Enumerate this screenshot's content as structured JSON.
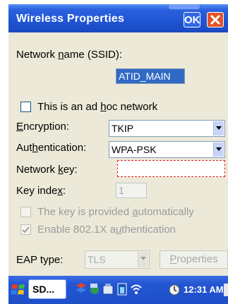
{
  "window": {
    "title": "Wireless Properties",
    "ok_label": "OK"
  },
  "form": {
    "ssid_label_pre": "Network ",
    "ssid_label_key": "n",
    "ssid_label_post": "ame (SSID):",
    "ssid_value": "ATID_MAIN",
    "adhoc_pre": "This is an ad ",
    "adhoc_key": "h",
    "adhoc_post": "oc network",
    "adhoc_checked": false,
    "encryption_key": "E",
    "encryption_post": "ncryption:",
    "encryption_value": "TKIP",
    "auth_pre": "Aut",
    "auth_key": "h",
    "auth_post": "entication:",
    "auth_value": "WPA-PSK",
    "netkey_pre": "Network ",
    "netkey_key": "k",
    "netkey_post": "ey:",
    "netkey_value": "",
    "keyidx_pre": "Key inde",
    "keyidx_key": "x",
    "keyidx_post": ":",
    "keyidx_value": "1",
    "keyauto_pre": "The key is provided ",
    "keyauto_key": "a",
    "keyauto_post": "utomatically",
    "keyauto_checked": false,
    "enable8021x_pre": "Enable 802.1X a",
    "enable8021x_key": "u",
    "enable8021x_post": "thentication",
    "enable8021x_checked": true,
    "eap_label": "EAP type:",
    "eap_value": "TLS",
    "properties_key": "P",
    "properties_post": "roperties"
  },
  "taskbar": {
    "task_label": "SD...",
    "clock": "12:31 AM"
  },
  "colors": {
    "title_bar": "#2c62df",
    "selection": "#316ac5",
    "close_button": "#e2542a"
  }
}
